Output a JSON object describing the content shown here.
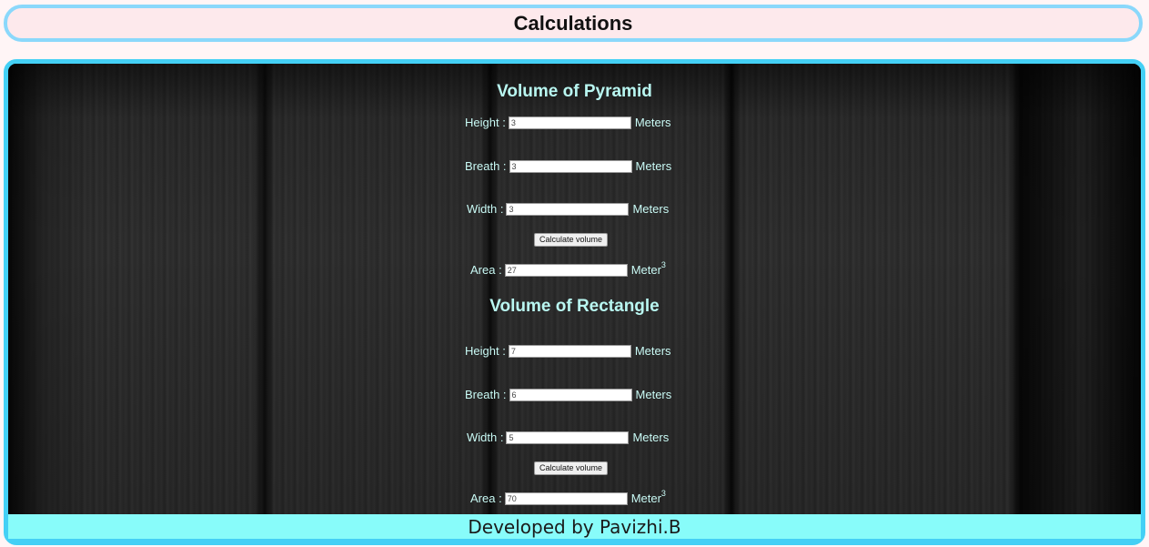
{
  "header": {
    "title": "Calculations"
  },
  "pyramid": {
    "title": "Volume of Pyramid",
    "height_label": "Height :",
    "height_value": "3",
    "breath_label": "Breath :",
    "breath_value": "3",
    "width_label": "Width :",
    "width_value": "3",
    "unit": "Meters",
    "button_label": "Calculate volume",
    "area_label": "Area :",
    "area_value": "27",
    "area_unit": "Meter",
    "area_unit_exp": "3"
  },
  "rectangle": {
    "title": "Volume of Rectangle",
    "height_label": "Height :",
    "height_value": "7",
    "breath_label": "Breath :",
    "breath_value": "6",
    "width_label": "Width :",
    "width_value": "5",
    "unit": "Meters",
    "button_label": "Calculate volume",
    "area_label": "Area :",
    "area_value": "70",
    "area_unit": "Meter",
    "area_unit_exp": "3"
  },
  "footer": {
    "text": "Developed by Pavizhi.B"
  },
  "colors": {
    "header_border": "#8ad8fb",
    "main_border": "#44d0f5",
    "footer_bg": "#88fcfa",
    "heading_text": "#b9f7f1"
  }
}
